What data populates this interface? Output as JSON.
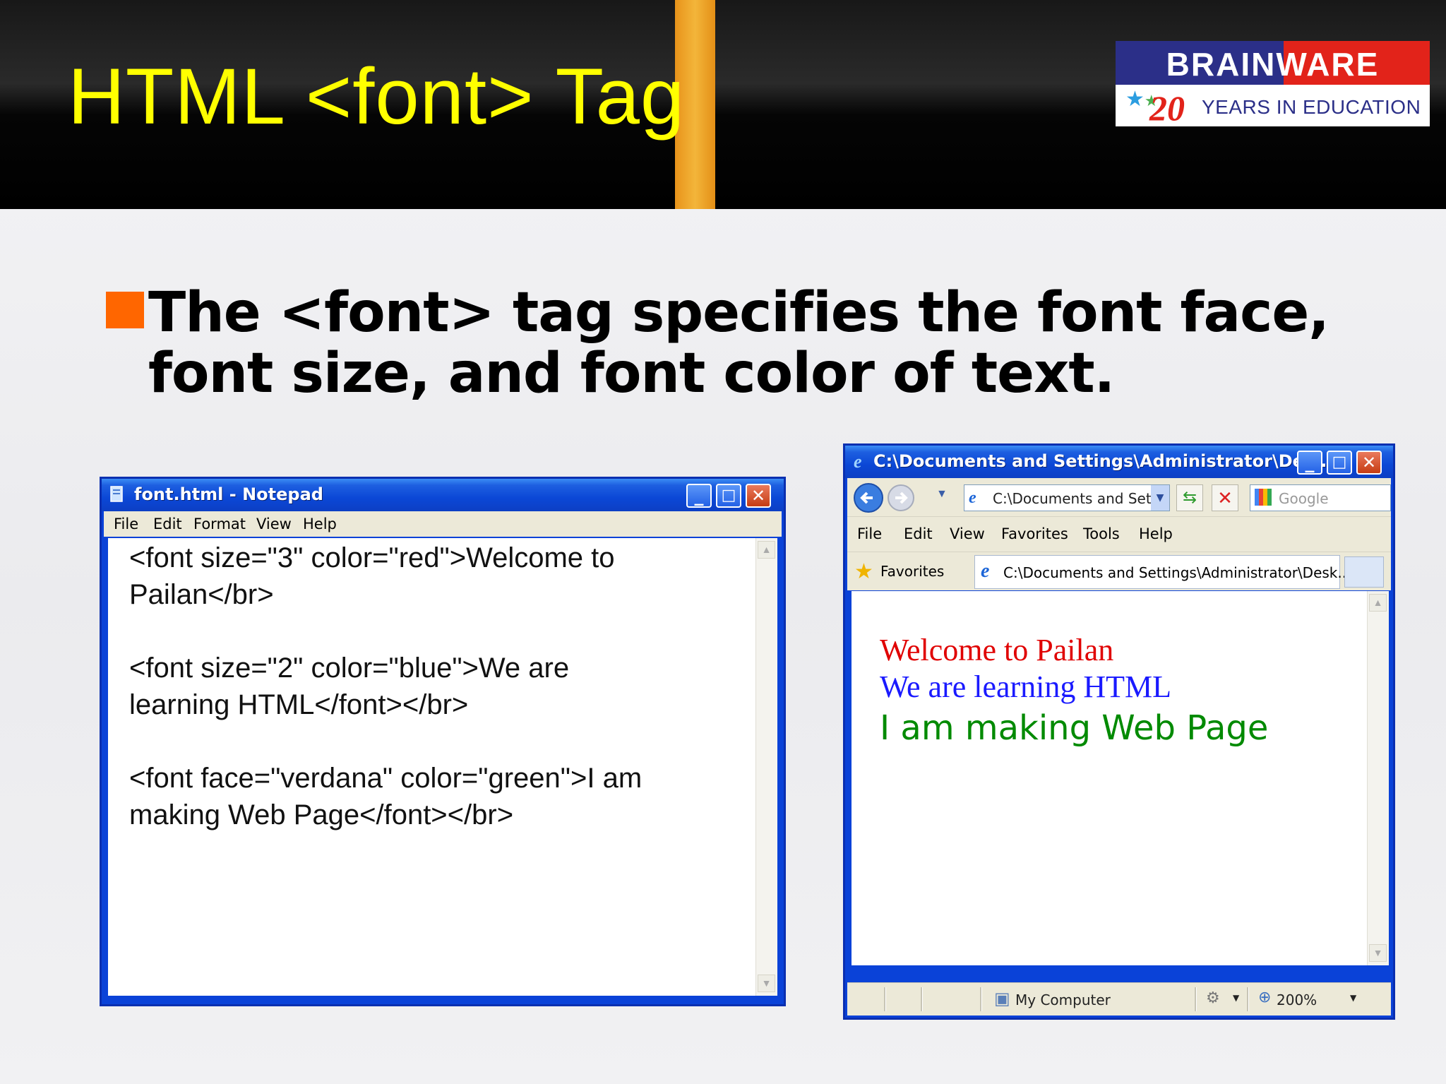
{
  "slide": {
    "title": "HTML <font> Tag",
    "bullet": "The <font> tag specifies the font face, font size, and font color of text."
  },
  "logo": {
    "brand": "BRAINWARE",
    "number": "20",
    "tagline": "YEARS IN EDUCATION"
  },
  "notepad": {
    "title": "font.html - Notepad",
    "menu": [
      "File",
      "Edit",
      "Format",
      "View",
      "Help"
    ],
    "lines": [
      "<font size=\"3\" color=\"red\">Welcome to",
      "Pailan</br>",
      "",
      "<font size=\"2\" color=\"blue\">We are",
      "learning HTML</font></br>",
      "",
      "<font face=\"verdana\" color=\"green\">I am",
      "making Web Page</font></br>"
    ]
  },
  "browser": {
    "title": "C:\\Documents and Settings\\Administrator\\Des...",
    "address": "C:\\Documents and Set",
    "search_placeholder": "Google",
    "menu": [
      "File",
      "Edit",
      "View",
      "Favorites",
      "Tools",
      "Help"
    ],
    "favorites_label": "Favorites",
    "tab_title": "C:\\Documents and Settings\\Administrator\\Desk...",
    "output": {
      "line1": "Welcome to Pailan",
      "line2": "We are learning HTML",
      "line3": "I am making Web Page"
    },
    "status": {
      "zone": "My Computer",
      "zoom": "200%"
    }
  },
  "colors": {
    "title_yellow": "#ffff00",
    "accent_orange": "#ff6600",
    "xp_blue": "#0a42d8"
  }
}
